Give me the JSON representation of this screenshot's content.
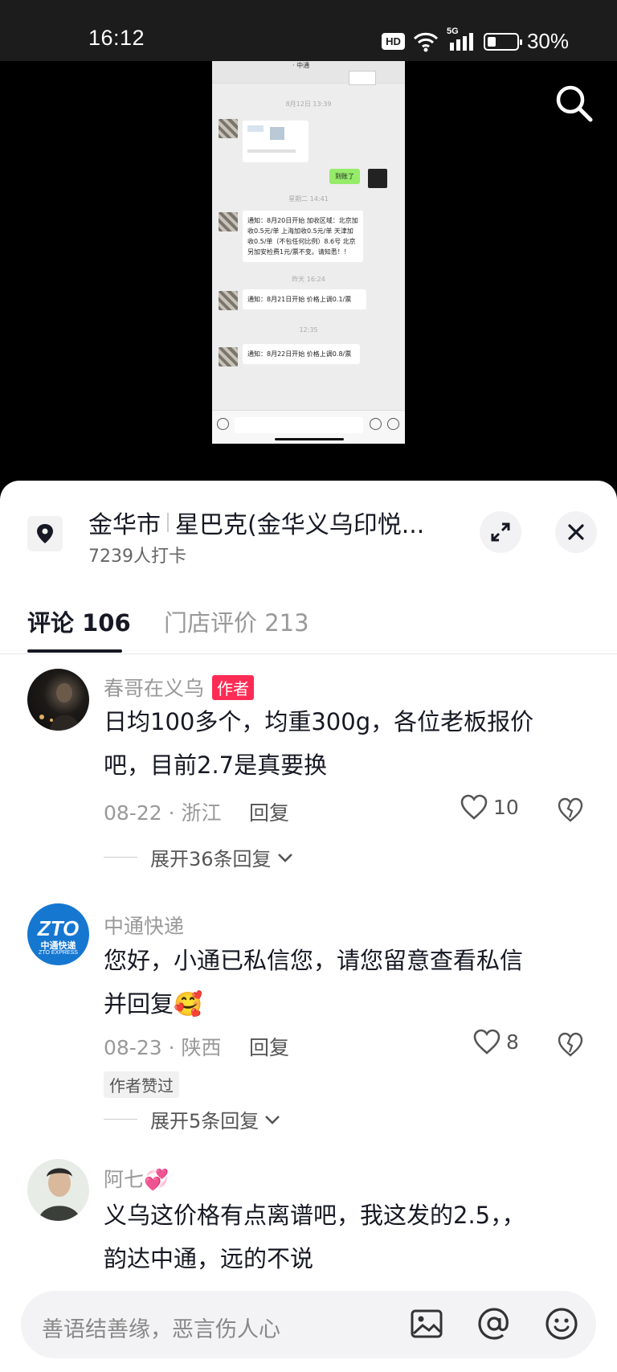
{
  "status_bar": {
    "time": "16:12",
    "hd": "HD",
    "network": "5G",
    "battery_percent_text": "30%",
    "battery_level": 0.3,
    "icons": [
      "hd-icon",
      "wifi-icon",
      "signal-icon",
      "battery-icon"
    ]
  },
  "video": {
    "search_icon": "search-icon",
    "screenshot": {
      "timestamps": [
        "8月12日 13:39",
        "星期二 14:41",
        "昨天 16:24",
        "12:35"
      ],
      "green_message": "到账了",
      "notices": [
        "通知：8月20日开始 加收区域：北京加收0.5元/单 上海加收0.5元/单 天津加收0.5/单（不包任何比例）8.6号 北京另加安检费1元/票不变。请知悉！！",
        "通知：8月21日开始 价格上调0.1/票",
        "通知：8月22日开始 价格上调0.8/票"
      ]
    }
  },
  "location": {
    "icon": "location-pin-icon",
    "city": "金华市",
    "place": "星巴克(金华义乌印悦...",
    "checkins": "7239人打卡",
    "expand_icon": "expand-icon",
    "close_icon": "close-icon"
  },
  "tabs": [
    {
      "label": "评论 106",
      "active": true
    },
    {
      "label": "门店评价 213",
      "active": false
    }
  ],
  "comments": [
    {
      "name": "春哥在义乌",
      "badge": "作者",
      "line1": "日均100多个，均重300g，各位老板报价",
      "line2": "吧，目前2.7是真要换",
      "meta": "08-22 · 浙江",
      "reply": "回复",
      "likes": "10",
      "expand": "展开36条回复"
    },
    {
      "name": "中通快递",
      "avatar_text": "ZTO",
      "avatar_sub": "中通快递",
      "avatar_sub2": "ZTO EXPRESS",
      "line1": "您好，小通已私信您，请您留意查看私信",
      "line2": "并回复🥰",
      "meta": "08-23 · 陕西",
      "reply": "回复",
      "likes": "8",
      "liked_by_author": "作者赞过",
      "expand": "展开5条回复"
    },
    {
      "name": "阿七💞",
      "line1": "义乌这价格有点离谱吧，我这发的2.5，，",
      "line2": "韵达中通，远的不说"
    }
  ],
  "input_bar": {
    "placeholder": "善语结善缘，恶言伤人心",
    "icons": [
      "image-icon",
      "at-icon",
      "emoji-icon"
    ]
  }
}
